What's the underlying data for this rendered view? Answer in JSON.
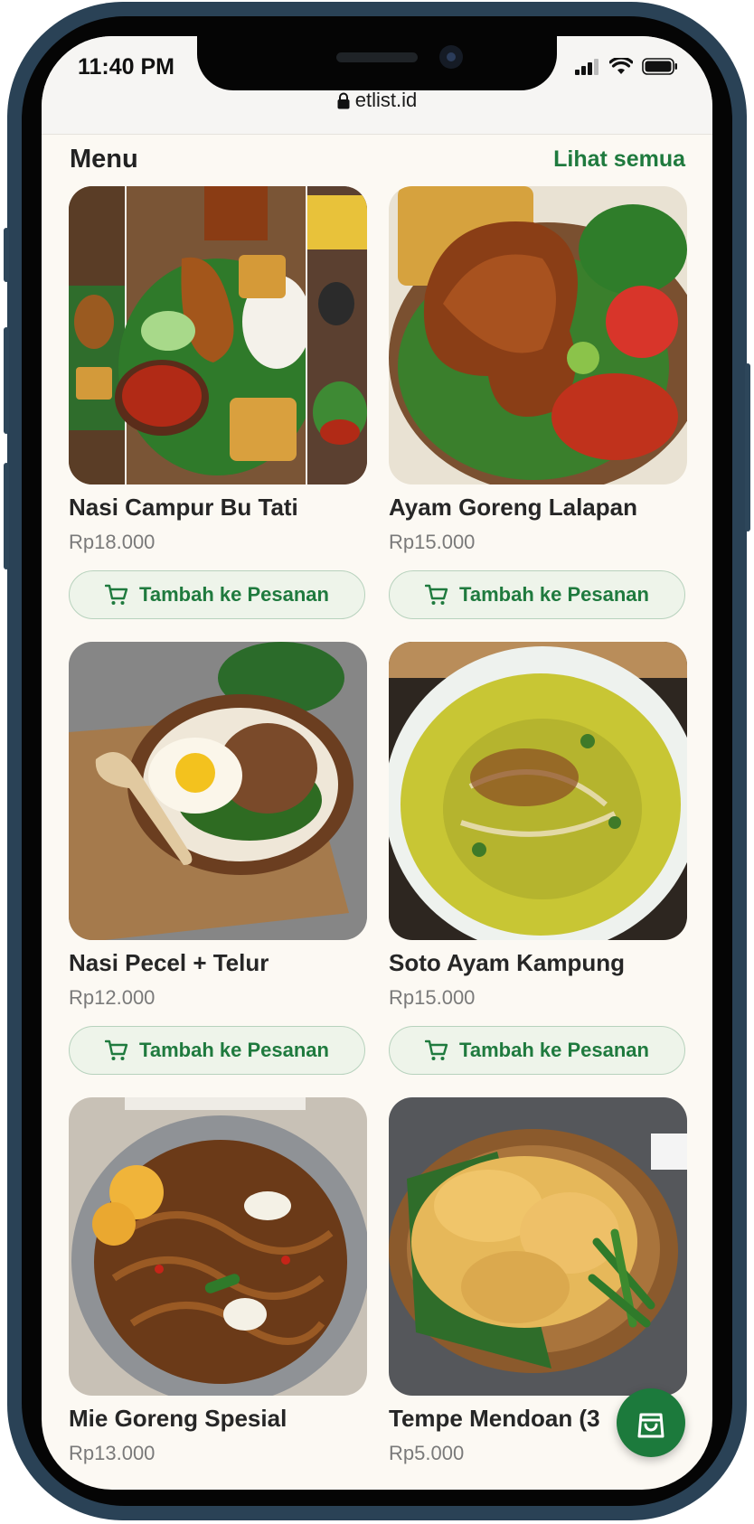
{
  "status": {
    "time": "11:40 PM"
  },
  "browser": {
    "url": "etlist.id"
  },
  "header": {
    "title": "Menu",
    "see_all": "Lihat semua"
  },
  "add_label": "Tambah ke Pesanan",
  "items": [
    {
      "name": "Nasi Campur Bu Tati",
      "price": "Rp18.000",
      "photo": "nasi-campur-photo"
    },
    {
      "name": "Ayam Goreng Lalapan",
      "price": "Rp15.000",
      "photo": "ayam-goreng-photo"
    },
    {
      "name": "Nasi Pecel + Telur",
      "price": "Rp12.000",
      "photo": "nasi-pecel-photo"
    },
    {
      "name": "Soto Ayam Kampung",
      "price": "Rp15.000",
      "photo": "soto-ayam-photo"
    },
    {
      "name": "Mie Goreng Spesial",
      "price": "Rp13.000",
      "photo": "mie-goreng-photo"
    },
    {
      "name": "Tempe Mendoan (3",
      "price": "Rp5.000",
      "photo": "tempe-mendoan-photo"
    }
  ],
  "colors": {
    "accent": "#1f7a3e",
    "background": "#fcf9f3",
    "fab": "#1c7a3c"
  },
  "icons": {
    "cart": "cart-icon",
    "bag": "shopping-bag-icon",
    "lock": "lock-icon"
  }
}
